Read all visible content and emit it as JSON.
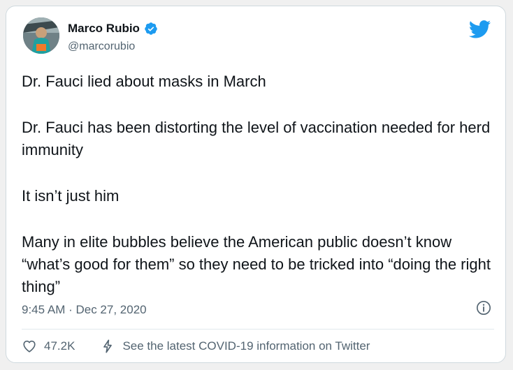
{
  "tweet": {
    "author": {
      "name": "Marco Rubio",
      "handle": "@marcorubio",
      "verified": true
    },
    "paragraphs": [
      "Dr. Fauci lied about masks in March",
      "Dr. Fauci has been distorting the level of vaccination needed for herd immunity",
      "It isn’t just him",
      "Many in elite bubbles believe the American public doesn’t know “what’s good for them” so they need to be tricked into “doing the right thing”"
    ],
    "timestamp": "9:45 AM · Dec 27, 2020",
    "likes": "47.2K",
    "covid_link": "See the latest COVID-19 information on Twitter"
  },
  "colors": {
    "twitter_blue": "#1d9bf0",
    "text_primary": "#0f1419",
    "text_secondary": "#536471"
  },
  "icons": [
    "verified-badge-icon",
    "twitter-bird-icon",
    "info-icon",
    "heart-icon",
    "lightning-bolt-icon"
  ]
}
